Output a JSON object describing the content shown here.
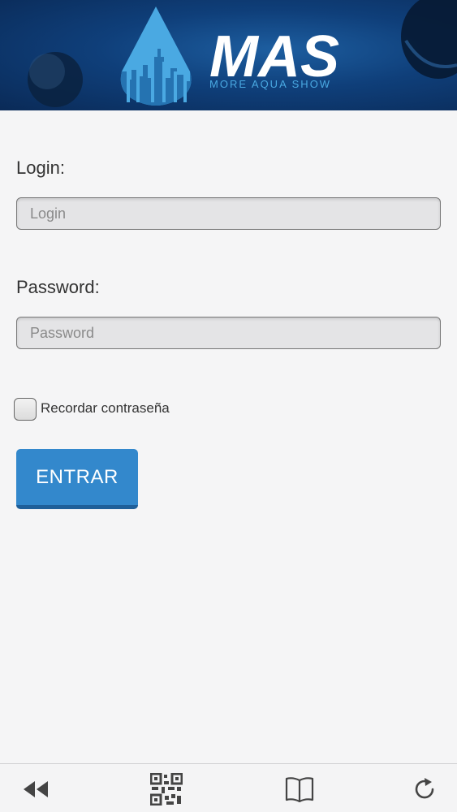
{
  "header": {
    "logo_text": "MAS",
    "logo_subtitle": "MORE AQUA SHOW"
  },
  "form": {
    "login_label": "Login:",
    "login_placeholder": "Login",
    "login_value": "",
    "password_label": "Password:",
    "password_placeholder": "Password",
    "password_value": "",
    "remember_label": "Recordar contraseña",
    "remember_checked": false,
    "submit_label": "ENTRAR"
  },
  "toolbar": {
    "items": [
      {
        "icon": "rewind-icon"
      },
      {
        "icon": "qr-code-icon"
      },
      {
        "icon": "book-icon"
      },
      {
        "icon": "refresh-icon"
      }
    ]
  },
  "colors": {
    "header_bg": "#0f3f7a",
    "accent_button": "#3388cc",
    "page_bg": "#f5f5f6"
  }
}
